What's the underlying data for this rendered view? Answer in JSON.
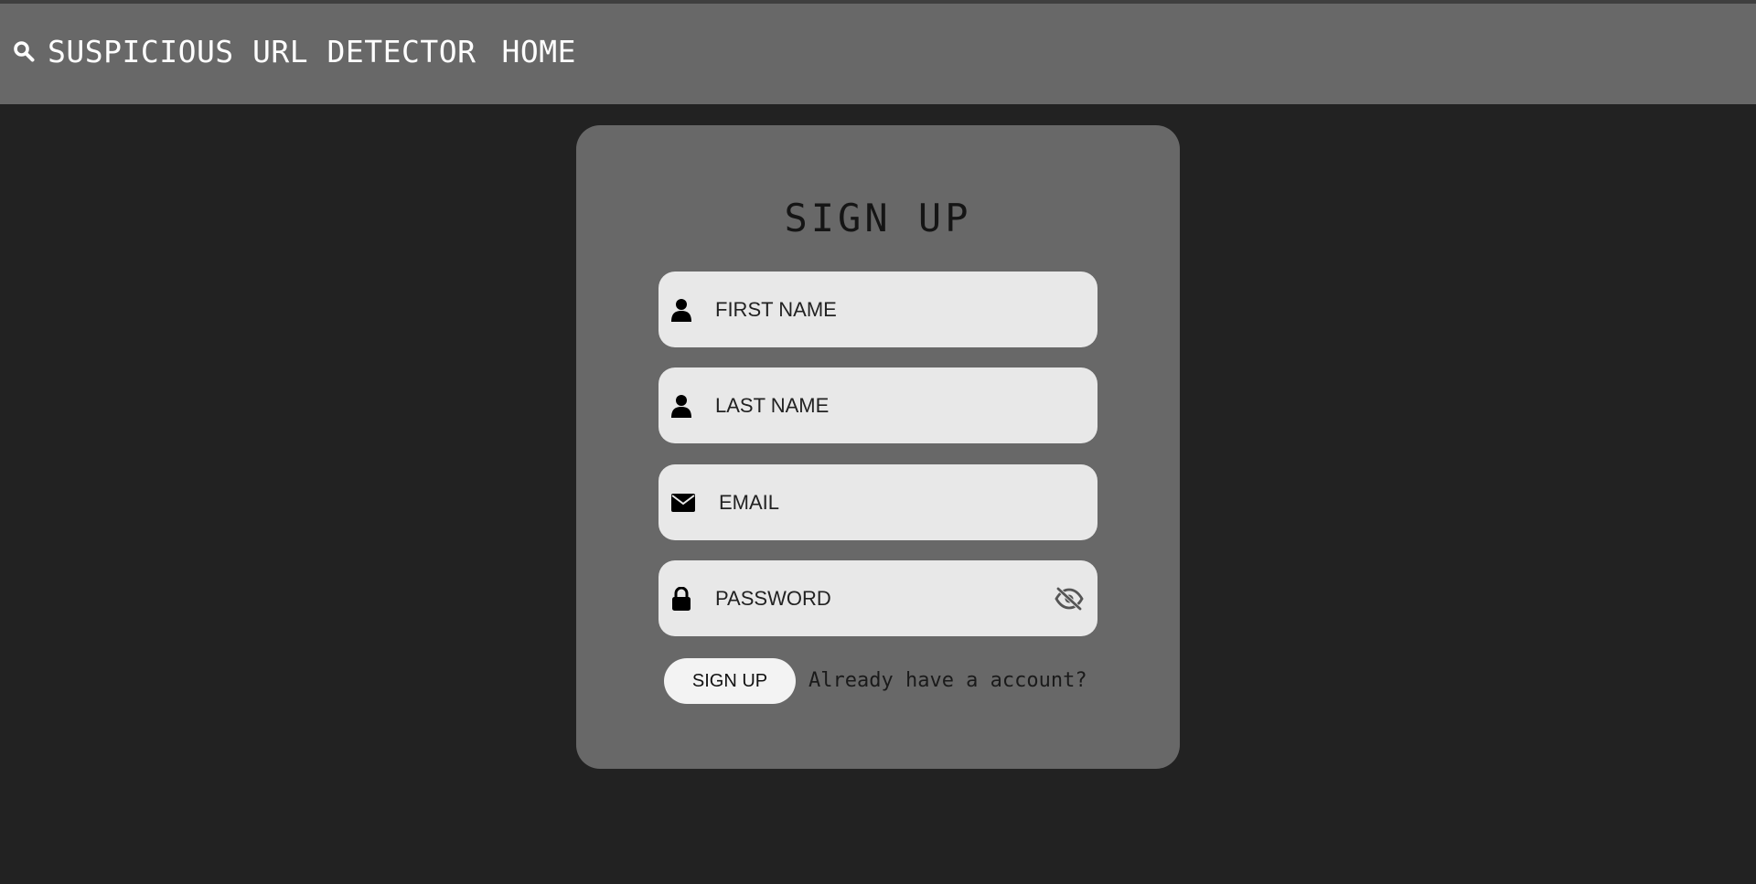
{
  "navbar": {
    "brand_label": "SUSPICIOUS URL DETECTOR",
    "brand_icon": "search-icon",
    "home_link": "HOME"
  },
  "form": {
    "title": "SIGN UP",
    "fields": [
      {
        "icon": "user-icon",
        "placeholder": "FIRST NAME"
      },
      {
        "icon": "user-icon",
        "placeholder": "LAST NAME"
      },
      {
        "icon": "envelope-icon",
        "placeholder": "EMAIL"
      },
      {
        "icon": "lock-icon",
        "placeholder": "PASSWORD",
        "toggle_icon": "eye-slash-icon"
      }
    ],
    "submit_label": "SIGN UP",
    "login_link": "Already have a account?"
  },
  "colors": {
    "page_background": "#222222",
    "navbar_background": "#686868",
    "card_background": "#686868",
    "field_background": "#e8e8e8",
    "button_background": "#f3f3f3"
  }
}
